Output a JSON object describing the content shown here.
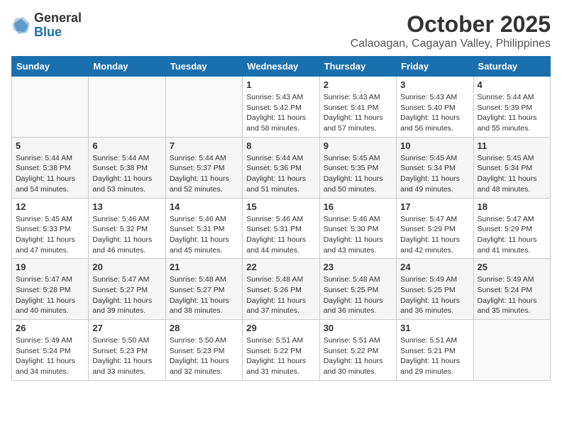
{
  "header": {
    "logo_general": "General",
    "logo_blue": "Blue",
    "month": "October 2025",
    "location": "Calaoagan, Cagayan Valley, Philippines"
  },
  "weekdays": [
    "Sunday",
    "Monday",
    "Tuesday",
    "Wednesday",
    "Thursday",
    "Friday",
    "Saturday"
  ],
  "weeks": [
    [
      {
        "day": "",
        "sunrise": "",
        "sunset": "",
        "daylight": ""
      },
      {
        "day": "",
        "sunrise": "",
        "sunset": "",
        "daylight": ""
      },
      {
        "day": "",
        "sunrise": "",
        "sunset": "",
        "daylight": ""
      },
      {
        "day": "1",
        "sunrise": "Sunrise: 5:43 AM",
        "sunset": "Sunset: 5:42 PM",
        "daylight": "Daylight: 11 hours and 58 minutes."
      },
      {
        "day": "2",
        "sunrise": "Sunrise: 5:43 AM",
        "sunset": "Sunset: 5:41 PM",
        "daylight": "Daylight: 11 hours and 57 minutes."
      },
      {
        "day": "3",
        "sunrise": "Sunrise: 5:43 AM",
        "sunset": "Sunset: 5:40 PM",
        "daylight": "Daylight: 11 hours and 56 minutes."
      },
      {
        "day": "4",
        "sunrise": "Sunrise: 5:44 AM",
        "sunset": "Sunset: 5:39 PM",
        "daylight": "Daylight: 11 hours and 55 minutes."
      }
    ],
    [
      {
        "day": "5",
        "sunrise": "Sunrise: 5:44 AM",
        "sunset": "Sunset: 5:38 PM",
        "daylight": "Daylight: 11 hours and 54 minutes."
      },
      {
        "day": "6",
        "sunrise": "Sunrise: 5:44 AM",
        "sunset": "Sunset: 5:38 PM",
        "daylight": "Daylight: 11 hours and 53 minutes."
      },
      {
        "day": "7",
        "sunrise": "Sunrise: 5:44 AM",
        "sunset": "Sunset: 5:37 PM",
        "daylight": "Daylight: 11 hours and 52 minutes."
      },
      {
        "day": "8",
        "sunrise": "Sunrise: 5:44 AM",
        "sunset": "Sunset: 5:36 PM",
        "daylight": "Daylight: 11 hours and 51 minutes."
      },
      {
        "day": "9",
        "sunrise": "Sunrise: 5:45 AM",
        "sunset": "Sunset: 5:35 PM",
        "daylight": "Daylight: 11 hours and 50 minutes."
      },
      {
        "day": "10",
        "sunrise": "Sunrise: 5:45 AM",
        "sunset": "Sunset: 5:34 PM",
        "daylight": "Daylight: 11 hours and 49 minutes."
      },
      {
        "day": "11",
        "sunrise": "Sunrise: 5:45 AM",
        "sunset": "Sunset: 5:34 PM",
        "daylight": "Daylight: 11 hours and 48 minutes."
      }
    ],
    [
      {
        "day": "12",
        "sunrise": "Sunrise: 5:45 AM",
        "sunset": "Sunset: 5:33 PM",
        "daylight": "Daylight: 11 hours and 47 minutes."
      },
      {
        "day": "13",
        "sunrise": "Sunrise: 5:46 AM",
        "sunset": "Sunset: 5:32 PM",
        "daylight": "Daylight: 11 hours and 46 minutes."
      },
      {
        "day": "14",
        "sunrise": "Sunrise: 5:46 AM",
        "sunset": "Sunset: 5:31 PM",
        "daylight": "Daylight: 11 hours and 45 minutes."
      },
      {
        "day": "15",
        "sunrise": "Sunrise: 5:46 AM",
        "sunset": "Sunset: 5:31 PM",
        "daylight": "Daylight: 11 hours and 44 minutes."
      },
      {
        "day": "16",
        "sunrise": "Sunrise: 5:46 AM",
        "sunset": "Sunset: 5:30 PM",
        "daylight": "Daylight: 11 hours and 43 minutes."
      },
      {
        "day": "17",
        "sunrise": "Sunrise: 5:47 AM",
        "sunset": "Sunset: 5:29 PM",
        "daylight": "Daylight: 11 hours and 42 minutes."
      },
      {
        "day": "18",
        "sunrise": "Sunrise: 5:47 AM",
        "sunset": "Sunset: 5:29 PM",
        "daylight": "Daylight: 11 hours and 41 minutes."
      }
    ],
    [
      {
        "day": "19",
        "sunrise": "Sunrise: 5:47 AM",
        "sunset": "Sunset: 5:28 PM",
        "daylight": "Daylight: 11 hours and 40 minutes."
      },
      {
        "day": "20",
        "sunrise": "Sunrise: 5:47 AM",
        "sunset": "Sunset: 5:27 PM",
        "daylight": "Daylight: 11 hours and 39 minutes."
      },
      {
        "day": "21",
        "sunrise": "Sunrise: 5:48 AM",
        "sunset": "Sunset: 5:27 PM",
        "daylight": "Daylight: 11 hours and 38 minutes."
      },
      {
        "day": "22",
        "sunrise": "Sunrise: 5:48 AM",
        "sunset": "Sunset: 5:26 PM",
        "daylight": "Daylight: 11 hours and 37 minutes."
      },
      {
        "day": "23",
        "sunrise": "Sunrise: 5:48 AM",
        "sunset": "Sunset: 5:25 PM",
        "daylight": "Daylight: 11 hours and 36 minutes."
      },
      {
        "day": "24",
        "sunrise": "Sunrise: 5:49 AM",
        "sunset": "Sunset: 5:25 PM",
        "daylight": "Daylight: 11 hours and 36 minutes."
      },
      {
        "day": "25",
        "sunrise": "Sunrise: 5:49 AM",
        "sunset": "Sunset: 5:24 PM",
        "daylight": "Daylight: 11 hours and 35 minutes."
      }
    ],
    [
      {
        "day": "26",
        "sunrise": "Sunrise: 5:49 AM",
        "sunset": "Sunset: 5:24 PM",
        "daylight": "Daylight: 11 hours and 34 minutes."
      },
      {
        "day": "27",
        "sunrise": "Sunrise: 5:50 AM",
        "sunset": "Sunset: 5:23 PM",
        "daylight": "Daylight: 11 hours and 33 minutes."
      },
      {
        "day": "28",
        "sunrise": "Sunrise: 5:50 AM",
        "sunset": "Sunset: 5:23 PM",
        "daylight": "Daylight: 11 hours and 32 minutes."
      },
      {
        "day": "29",
        "sunrise": "Sunrise: 5:51 AM",
        "sunset": "Sunset: 5:22 PM",
        "daylight": "Daylight: 11 hours and 31 minutes."
      },
      {
        "day": "30",
        "sunrise": "Sunrise: 5:51 AM",
        "sunset": "Sunset: 5:22 PM",
        "daylight": "Daylight: 11 hours and 30 minutes."
      },
      {
        "day": "31",
        "sunrise": "Sunrise: 5:51 AM",
        "sunset": "Sunset: 5:21 PM",
        "daylight": "Daylight: 11 hours and 29 minutes."
      },
      {
        "day": "",
        "sunrise": "",
        "sunset": "",
        "daylight": ""
      }
    ]
  ]
}
